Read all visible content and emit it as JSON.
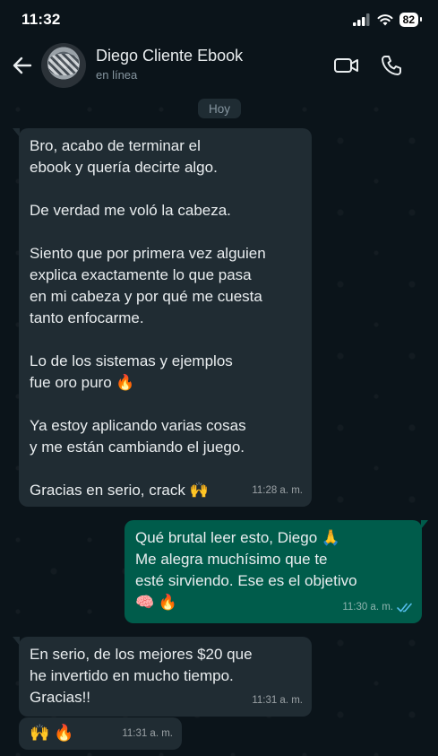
{
  "status_bar": {
    "time": "11:32",
    "battery": "82"
  },
  "header": {
    "contact_name": "Diego Cliente Ebook",
    "contact_status": "en línea"
  },
  "chat": {
    "date_label": "Hoy",
    "messages": [
      {
        "direction": "incoming",
        "text": "Bro, acabo de terminar el\nebook y quería decirte algo.\n\nDe verdad me voló la cabeza.\n\nSiento que por primera vez alguien\nexplica exactamente lo que pasa\nen mi cabeza y por qué me cuesta\ntanto enfocarme.\n\nLo de los sistemas y ejemplos\nfue oro puro 🔥\n\nYa estoy aplicando varias cosas\ny me están cambiando el juego.\n\nGracias en serio, crack 🙌",
        "time": "11:28 a. m."
      },
      {
        "direction": "outgoing",
        "text": "Qué brutal leer esto, Diego 🙏\nMe alegra muchísimo que te\nesté sirviendo. Ese es el objetivo\n🧠 🔥",
        "time": "11:30 a. m.",
        "status": "read"
      },
      {
        "direction": "incoming",
        "text": "En serio, de los mejores $20 que\nhe invertido en mucho tiempo.\nGracias!!",
        "time": "11:31 a. m."
      },
      {
        "direction": "incoming",
        "text": "🙌 🔥",
        "time": "11:31 a. m."
      }
    ]
  },
  "colors": {
    "background": "#0b141a",
    "incoming_bubble": "#202c33",
    "outgoing_bubble": "#005c4b",
    "read_ticks": "#53bdeb"
  },
  "icons": [
    "back-arrow-icon",
    "video-call-icon",
    "phone-call-icon",
    "signal-icon",
    "wifi-icon",
    "battery-icon",
    "read-ticks-icon"
  ]
}
